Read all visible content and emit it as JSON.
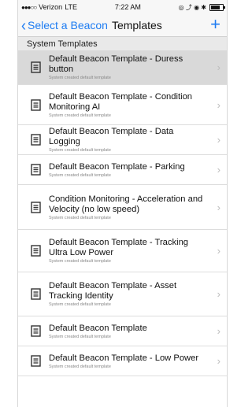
{
  "status_bar": {
    "dots": "●●●○○",
    "carrier": "Verizon",
    "network": "LTE",
    "time": "7:22 AM",
    "icons": "◎ ⤴ ◉ ✱"
  },
  "nav": {
    "back_label": "Select a Beacon",
    "title": "Templates",
    "add": "+"
  },
  "section_header": "System Templates",
  "templates": [
    {
      "title": "Default Beacon Template - Duress button",
      "subtitle": "System created default template"
    },
    {
      "title": "Default Beacon Template - Condition Monitoring AI",
      "subtitle": "System created default template"
    },
    {
      "title": "Default Beacon Template - Data Logging",
      "subtitle": "System created default template"
    },
    {
      "title": "Default Beacon Template - Parking",
      "subtitle": "System created default template"
    },
    {
      "title": "Condition Monitoring - Acceleration and Velocity (no low speed)",
      "subtitle": "System created default template"
    },
    {
      "title": "Default Beacon Template - Tracking Ultra Low Power",
      "subtitle": "System created default template"
    },
    {
      "title": "Default Beacon Template - Asset Tracking Identity",
      "subtitle": "System created default template"
    },
    {
      "title": "Default Beacon Template",
      "subtitle": "System created default template"
    },
    {
      "title": "Default Beacon Template - Low Power",
      "subtitle": "System created default template"
    }
  ],
  "colors": {
    "accent": "#1e7cf2",
    "selected_row": "#d9d9d9",
    "section_bg": "#e9e9e9"
  }
}
